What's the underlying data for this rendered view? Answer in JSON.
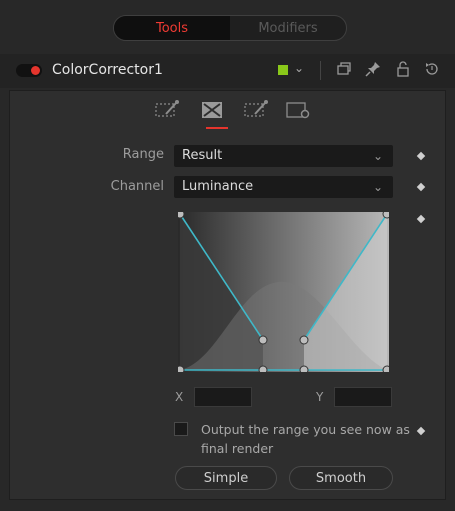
{
  "top_tabs": {
    "tools": "Tools",
    "modifiers": "Modifiers"
  },
  "node": {
    "name": "ColorCorrector1",
    "color": "#8ac81a"
  },
  "range": {
    "label": "Range",
    "value": "Result"
  },
  "channel": {
    "label": "Channel",
    "value": "Luminance"
  },
  "xy": {
    "x_label": "X",
    "y_label": "Y",
    "x_value": "",
    "y_value": ""
  },
  "checkbox": {
    "label": "Output the range you see now as final render",
    "checked": false
  },
  "buttons": {
    "simple": "Simple",
    "smooth": "Smooth"
  },
  "icons": {
    "top_right": [
      "overlay-icon",
      "pin-icon",
      "lock-icon",
      "reset-icon"
    ],
    "subtabs": [
      "correction-tab-icon",
      "ranges-tab-icon",
      "options-tab-icon",
      "settings-tab-icon"
    ]
  },
  "colors": {
    "accent_red": "#e5352d",
    "curve_cyan": "#3fb8c8"
  }
}
